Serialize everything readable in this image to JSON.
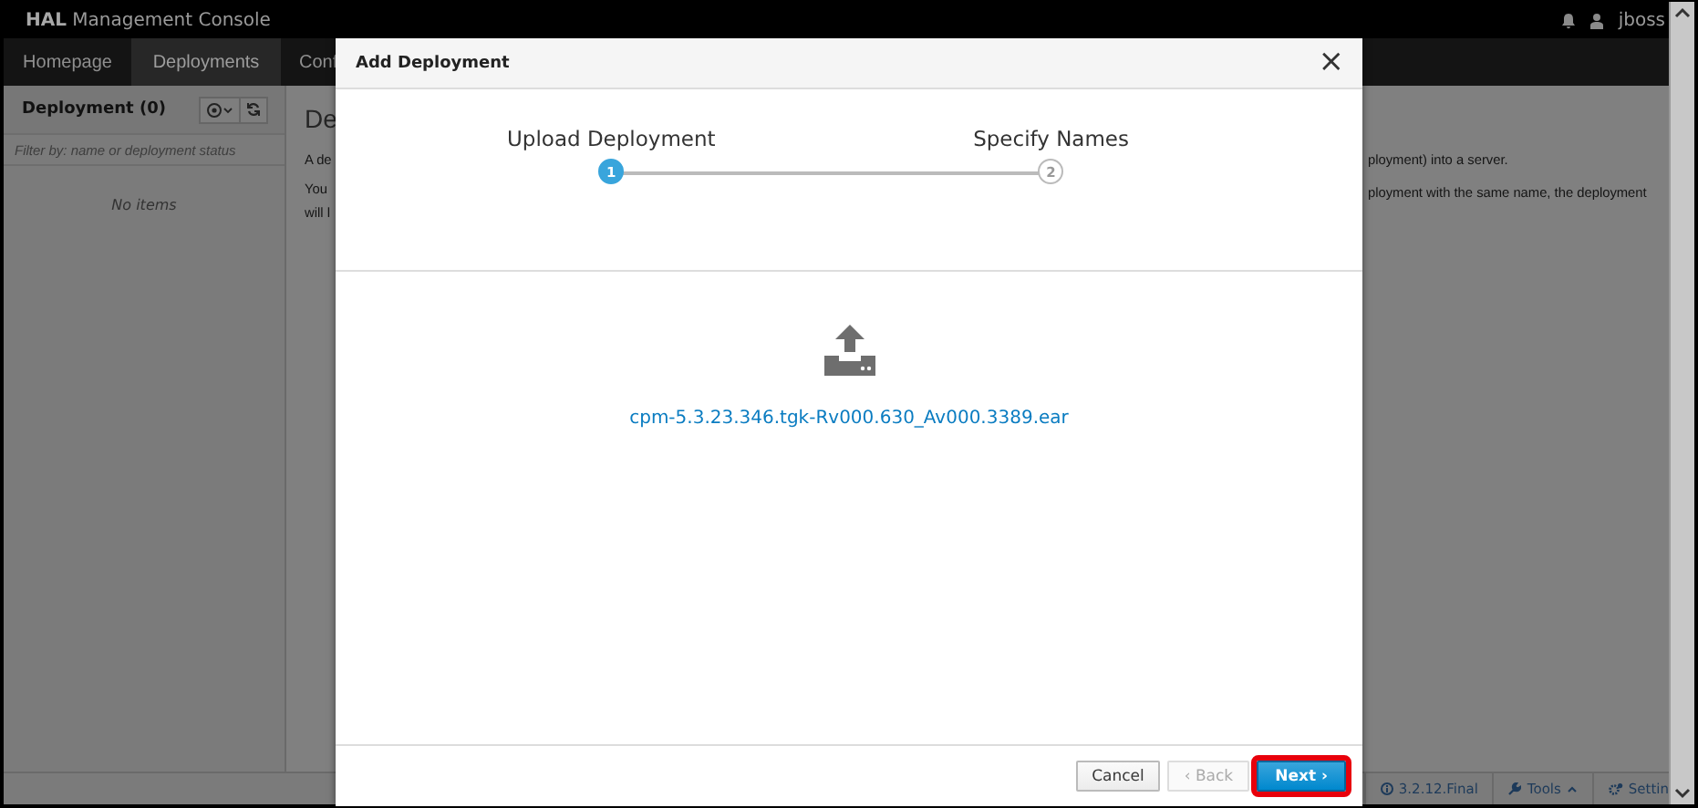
{
  "header": {
    "title": "**HAL** Management Console",
    "user": "jboss"
  },
  "nav": {
    "tabs": [
      {
        "label": "Homepage",
        "selected": false
      },
      {
        "label": "Deployments",
        "selected": true
      },
      {
        "label": "Conf",
        "selected": false
      }
    ]
  },
  "sidebar": {
    "title": "Deployment (0)",
    "filter": {
      "placeholder": "Filter by: name or deployment status"
    },
    "empty_text": "No items"
  },
  "content": {
    "title": "De",
    "left_lines": [
      "A de",
      "You",
      "will l"
    ],
    "right_lines": [
      "ployment) into a server.",
      "ployment with the same name, the deployment"
    ]
  },
  "footer": {
    "version": "3.2.12.Final",
    "tools": "Tools",
    "settings": "Settin"
  },
  "dialog": {
    "title": "Add Deployment",
    "close": "×",
    "steps": [
      {
        "number": "1",
        "label": "Upload Deployment",
        "selected": true
      },
      {
        "number": "2",
        "label": "Specify Names",
        "selected": false
      }
    ],
    "file_name": "cpm-5.3.23.346.tgk-Rv000.630_Av000.3389.ear",
    "buttons": [
      {
        "label": "Cancel",
        "kind": "default",
        "disabled": false,
        "highlighted": false
      },
      {
        "label": "‹ Back",
        "kind": "default",
        "disabled": true,
        "highlighted": false
      },
      {
        "label": "Next ›",
        "kind": "primary",
        "disabled": false,
        "highlighted": true
      }
    ]
  }
}
